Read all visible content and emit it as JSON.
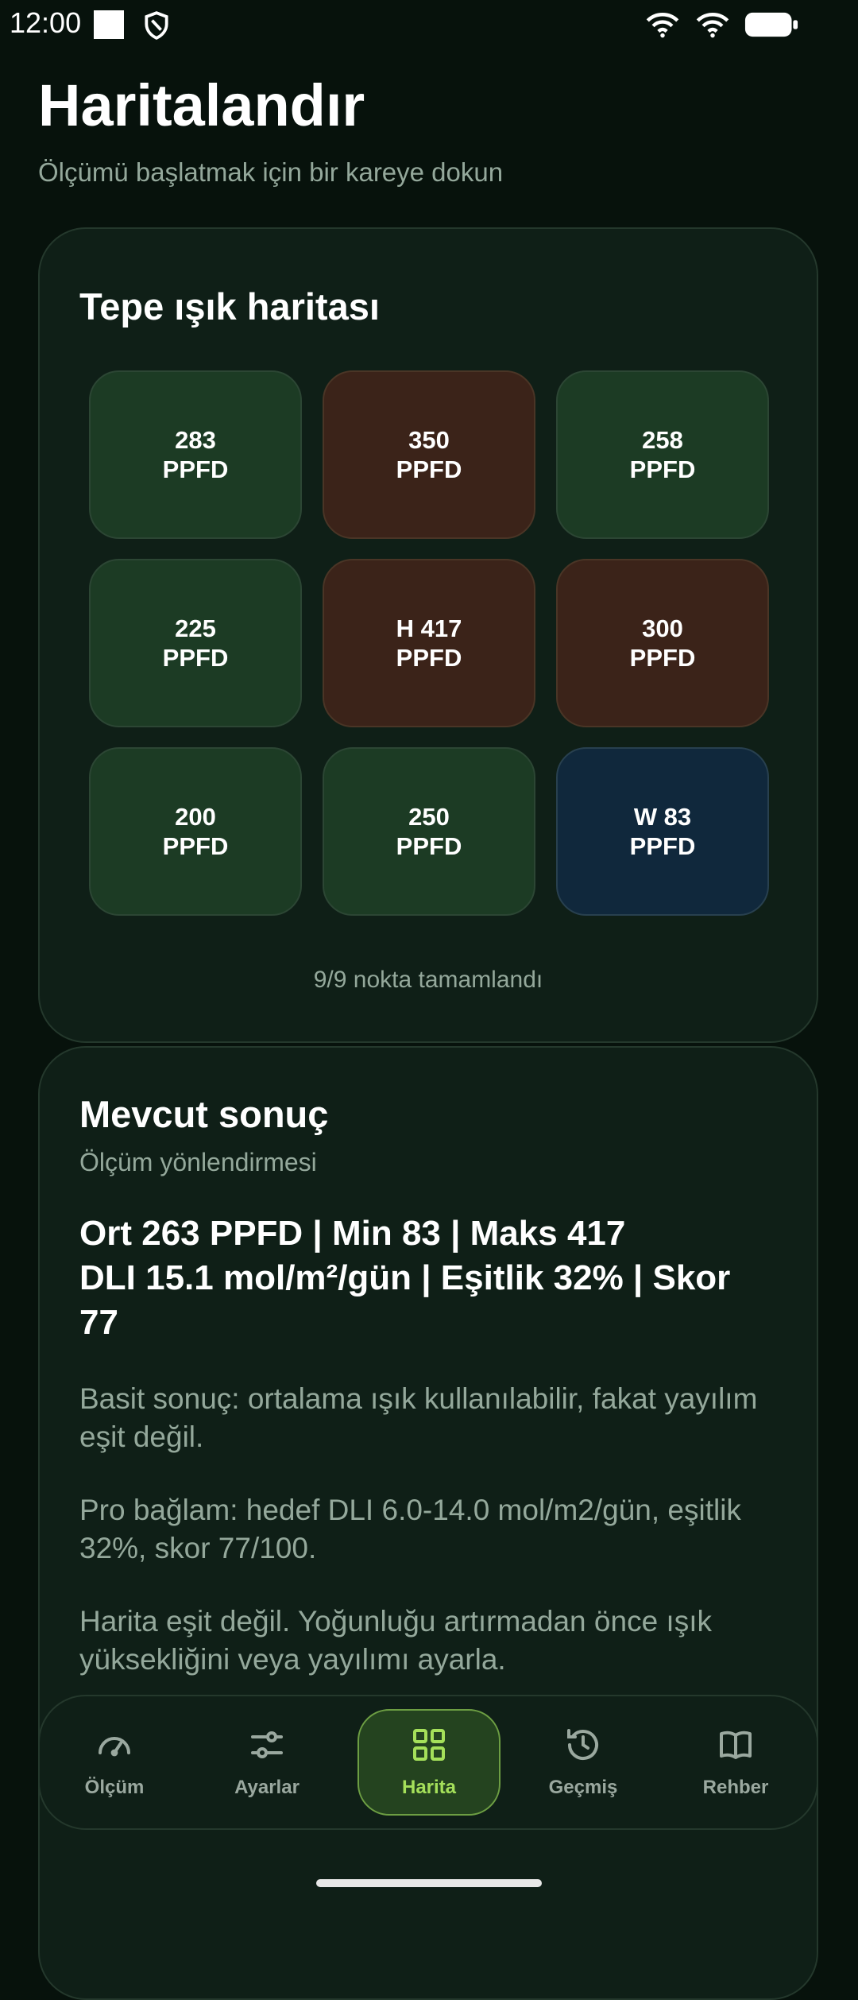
{
  "status": {
    "time": "12:00"
  },
  "header": {
    "title": "Haritalandır",
    "subtitle": "Ölçümü başlatmak için bir kareye dokun"
  },
  "map_card": {
    "title": "Tepe ışık haritası",
    "cells": [
      {
        "value": "283",
        "unit": "PPFD",
        "tone": "green"
      },
      {
        "value": "350",
        "unit": "PPFD",
        "tone": "brown"
      },
      {
        "value": "258",
        "unit": "PPFD",
        "tone": "green"
      },
      {
        "value": "225",
        "unit": "PPFD",
        "tone": "green"
      },
      {
        "value": "H 417",
        "unit": "PPFD",
        "tone": "brown"
      },
      {
        "value": "300",
        "unit": "PPFD",
        "tone": "brown"
      },
      {
        "value": "200",
        "unit": "PPFD",
        "tone": "green"
      },
      {
        "value": "250",
        "unit": "PPFD",
        "tone": "green"
      },
      {
        "value": "W 83",
        "unit": "PPFD",
        "tone": "blue"
      }
    ],
    "progress": "9/9 nokta tamamlandı"
  },
  "result_card": {
    "title": "Mevcut sonuç",
    "subtitle": "Ölçüm yönlendirmesi",
    "stats_line1": "Ort 263 PPFD | Min 83 | Maks 417",
    "stats_line2": "DLI 15.1 mol/m²/gün | Eşitlik 32% | Skor 77",
    "simple": "Basit sonuç: ortalama ışık kullanılabilir, fakat yayılım eşit değil.",
    "pro": "Pro bağlam: hedef DLI 6.0-14.0 mol/m2/gün, eşitlik 32%, skor 77/100.",
    "advice": "Harita eşit değil. Yoğunluğu artırmadan önce ışık yüksekliğini veya yayılımı ayarla."
  },
  "nav": {
    "items": [
      {
        "label": "Ölçüm",
        "icon": "gauge-icon"
      },
      {
        "label": "Ayarlar",
        "icon": "sliders-icon"
      },
      {
        "label": "Harita",
        "icon": "grid-icon"
      },
      {
        "label": "Geçmiş",
        "icon": "history-icon"
      },
      {
        "label": "Rehber",
        "icon": "book-icon"
      }
    ],
    "active_index": 2
  },
  "colors": {
    "background": "#07120c",
    "card": "#0f1f17",
    "accent": "#a5e05a",
    "cell_green": "#1c3b24",
    "cell_brown": "#3b2319",
    "cell_blue": "#10283c"
  }
}
